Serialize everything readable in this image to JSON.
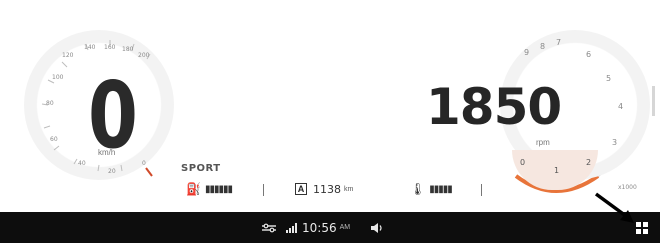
{
  "speedometer": {
    "value": "0",
    "unit": "km/h",
    "ticks": [
      "120",
      "140",
      "160",
      "180",
      "200",
      "100",
      "80",
      "60",
      "40",
      "20",
      "0"
    ]
  },
  "drive_mode": "SPORT",
  "tachometer": {
    "value": "1850",
    "unit": "rpm",
    "ticks": [
      "9",
      "8",
      "7",
      "6",
      "5",
      "4",
      "3",
      "2",
      "1",
      "0"
    ],
    "multiplier": "x1000",
    "accent_color": "#e8743a"
  },
  "info_row": {
    "odometer_mode": "A",
    "odometer_value": "1138",
    "odometer_unit": "km"
  },
  "status_bar": {
    "time": "10:56",
    "ampm": "AM"
  },
  "icons": {
    "fuel": "fuel-pump-icon",
    "coolant": "coolant-temperature-icon",
    "settings": "sliders-icon",
    "signal": "signal-strength-icon",
    "volume": "speaker-icon",
    "apps": "app-grid-icon",
    "pointer": "arrow-pointer-icon"
  }
}
